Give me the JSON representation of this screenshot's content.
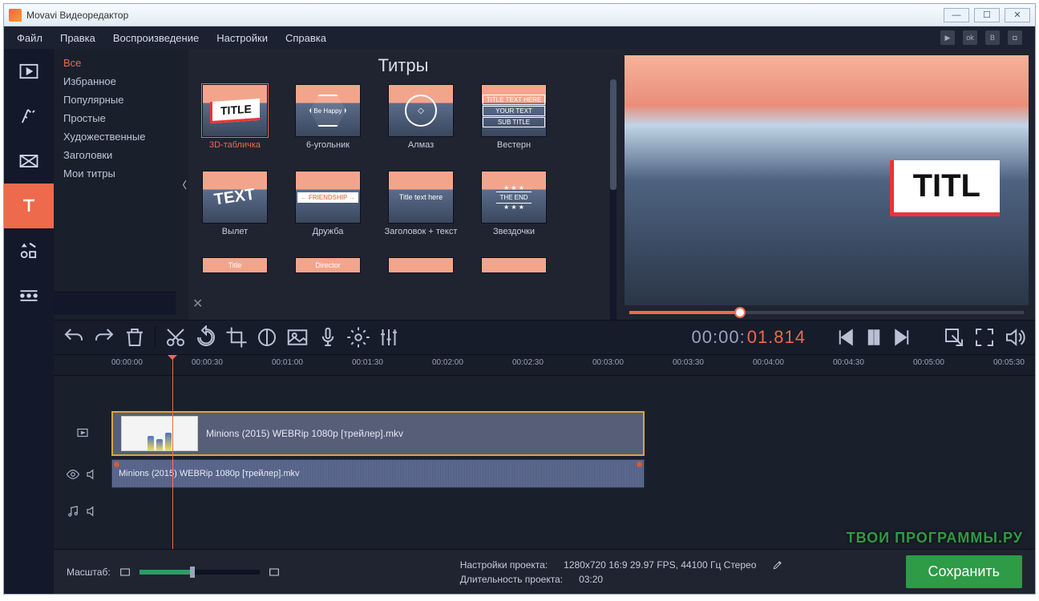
{
  "window": {
    "title": "Movavi Видеоредактор"
  },
  "menu": [
    "Файл",
    "Правка",
    "Воспроизведение",
    "Настройки",
    "Справка"
  ],
  "social_icons": [
    "youtube-icon",
    "odnoklassniki-icon",
    "vk-icon",
    "camera-icon"
  ],
  "sidebar_tools": [
    {
      "name": "media-tool"
    },
    {
      "name": "filters-tool"
    },
    {
      "name": "transitions-tool"
    },
    {
      "name": "titles-tool",
      "active": true
    },
    {
      "name": "stickers-tool"
    },
    {
      "name": "more-tool"
    }
  ],
  "titles_panel": {
    "heading": "Титры",
    "categories": [
      {
        "label": "Все",
        "active": true
      },
      {
        "label": "Избранное"
      },
      {
        "label": "Популярные"
      },
      {
        "label": "Простые"
      },
      {
        "label": "Художественные"
      },
      {
        "label": "Заголовки"
      },
      {
        "label": "Мои титры"
      }
    ],
    "items": [
      {
        "label": "3D-табличка",
        "selected": true,
        "variant": "plate",
        "text": "TITLE"
      },
      {
        "label": "6-угольник",
        "variant": "hex",
        "text": "Be Happy"
      },
      {
        "label": "Алмаз",
        "variant": "dia",
        "text": "◇"
      },
      {
        "label": "Вестерн",
        "variant": "west",
        "text": "YOUR TEXT"
      },
      {
        "label": "Вылет",
        "variant": "fly",
        "text": "TEXT"
      },
      {
        "label": "Дружба",
        "variant": "friend",
        "text": "FRIENDSHIP"
      },
      {
        "label": "Заголовок + текст",
        "variant": "tt",
        "text": "Title text here"
      },
      {
        "label": "Звездочки",
        "variant": "stars",
        "text": "THE END"
      }
    ],
    "peek_items": [
      {
        "text": "Title"
      },
      {
        "text": "Director"
      },
      {
        "text": ""
      },
      {
        "text": ""
      }
    ]
  },
  "preview": {
    "plate_text": "TITL"
  },
  "timecode": {
    "hhmmss": "00:00:",
    "frac": "01.814"
  },
  "ruler_ticks": [
    "00:00:00",
    "00:00:30",
    "00:01:00",
    "00:01:30",
    "00:02:00",
    "00:02:30",
    "00:03:00",
    "00:03:30",
    "00:04:00",
    "00:04:30",
    "00:05:00",
    "00:05:30"
  ],
  "clip": {
    "video_name": "Minions (2015) WEBRip 1080p [трейлер].mkv",
    "audio_name": "Minions (2015) WEBRip 1080p [трейлер].mkv"
  },
  "footer": {
    "zoom_label": "Масштаб:",
    "settings_label": "Настройки проекта:",
    "settings_value": "1280x720 16:9 29.97 FPS, 44100 Гц Стерео",
    "duration_label": "Длительность проекта:",
    "duration_value": "03:20",
    "save": "Сохранить",
    "watermark": "ТВОИ ПРОГРАММЫ.РУ"
  }
}
